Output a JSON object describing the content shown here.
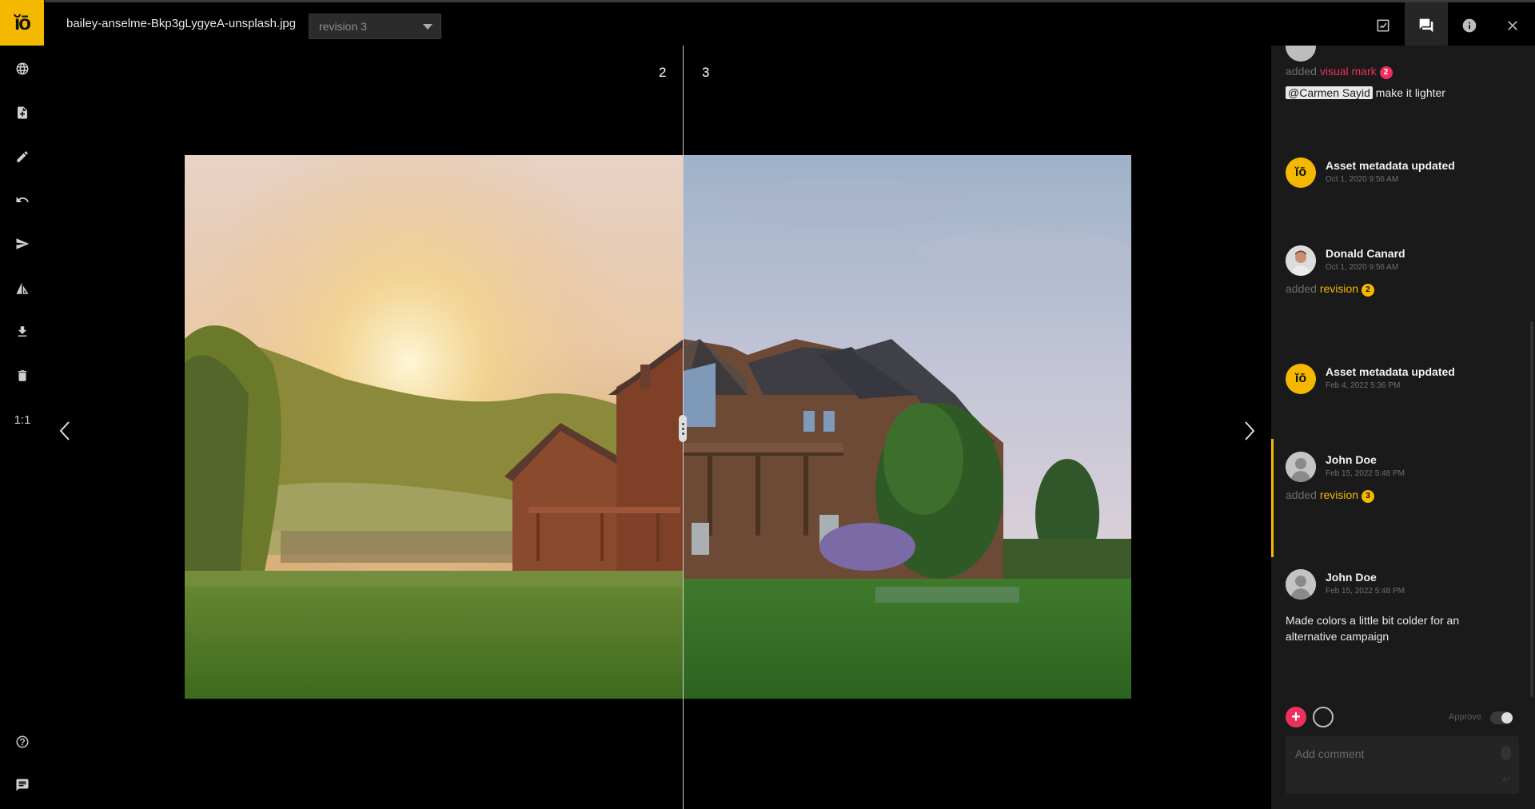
{
  "app": {
    "logo_text": "ĭō",
    "filename": "bailey-anselme-Bkp3gLygyeA-unsplash.jpg",
    "revision_selected": "revision 3"
  },
  "rail": {
    "items": [
      "globe-icon",
      "file-add-icon",
      "pencil-icon",
      "undo-icon",
      "send-icon",
      "compare-icon",
      "download-icon",
      "trash-icon"
    ],
    "zoom_label": "1:1",
    "bottom": [
      "help-icon",
      "feedback-icon"
    ]
  },
  "header_icons": [
    "chart-icon",
    "comments-icon",
    "info-icon",
    "close-icon"
  ],
  "viewer": {
    "left_revision": "2",
    "right_revision": "3"
  },
  "activity": [
    {
      "type": "markup",
      "action": "added",
      "link": "visual mark",
      "badge": "2",
      "mention": "@Carmen Sayid",
      "text": " make it lighter"
    },
    {
      "type": "system",
      "name": "Asset metadata updated",
      "time": "Oct 1, 2020 9:56 AM"
    },
    {
      "type": "revision",
      "name": "Donald Canard",
      "time": "Oct 1, 2020 9:56 AM",
      "action": "added",
      "link": "revision",
      "badge": "2"
    },
    {
      "type": "system",
      "name": "Asset metadata updated",
      "time": "Feb 4, 2022 5:36 PM"
    },
    {
      "type": "revision",
      "name": "John Doe",
      "time": "Feb 15, 2022 5:48 PM",
      "action": "added",
      "link": "revision",
      "badge": "3"
    },
    {
      "type": "comment",
      "name": "John Doe",
      "time": "Feb 15, 2022 5:48 PM",
      "text": "Made colors a little bit colder for an alternative campaign"
    }
  ],
  "composer": {
    "approve_label": "Approve",
    "placeholder": "Add comment",
    "plus_symbol": "+"
  },
  "colors": {
    "accent_yellow": "#f5b800",
    "accent_red": "#ef2f5c",
    "panel_bg": "#1a1a1a"
  }
}
